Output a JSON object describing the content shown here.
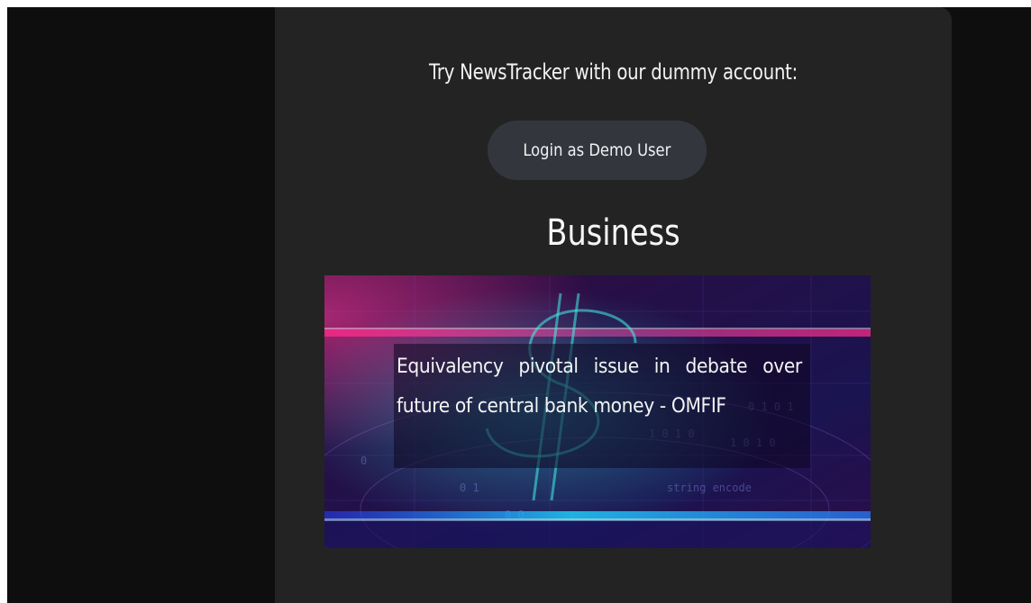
{
  "demo": {
    "prompt": "Try NewsTracker with our dummy account:",
    "login_label": "Login as Demo User"
  },
  "section": {
    "title": "Business"
  },
  "article": {
    "headline": "Equivalency pivotal issue in debate over future of central bank money - OMFIF"
  },
  "colors": {
    "page_bg": "#0e0e0e",
    "card_bg": "#232323",
    "button_bg": "#33373d",
    "text": "#f2f2f2",
    "image_magenta": "#ff2a8a",
    "image_cyan": "#21d4ff"
  }
}
